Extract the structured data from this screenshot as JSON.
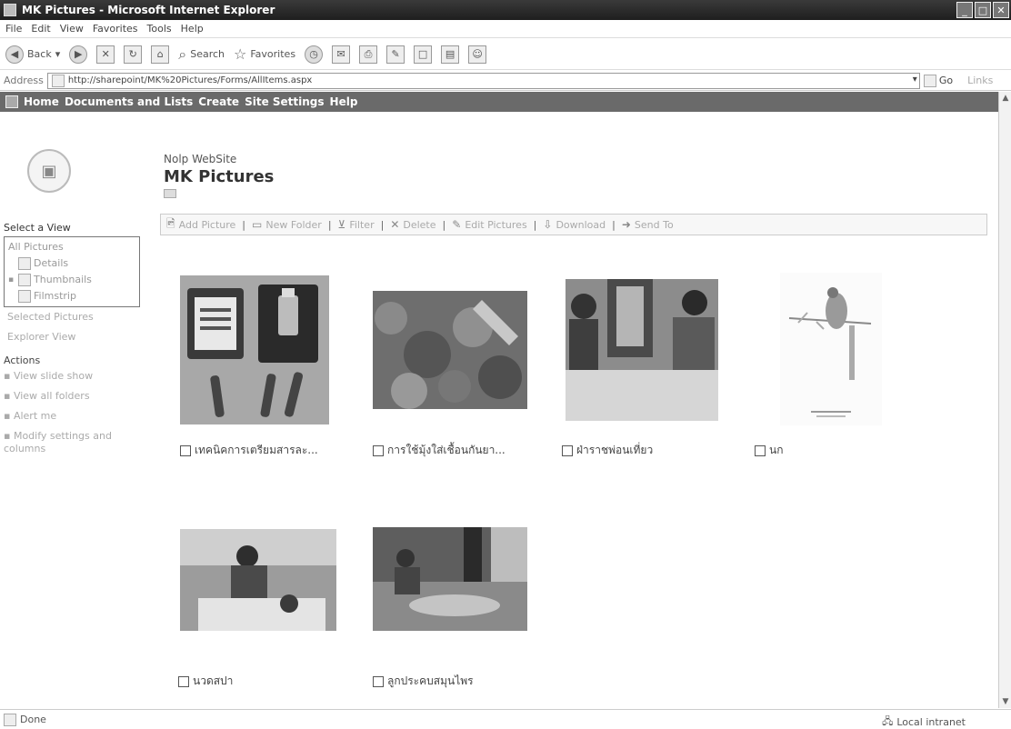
{
  "window": {
    "title": "MK Pictures - Microsoft Internet Explorer"
  },
  "menu": [
    "File",
    "Edit",
    "View",
    "Favorites",
    "Tools",
    "Help"
  ],
  "toolbar": {
    "back_label": "Back",
    "search_label": "Search",
    "favorites_label": "Favorites"
  },
  "address": {
    "label": "Address",
    "url": "http://sharepoint/MK%20Pictures/Forms/AllItems.aspx",
    "go_label": "Go",
    "links_label": "Links"
  },
  "topnav": [
    "Home",
    "Documents and Lists",
    "Create",
    "Site Settings",
    "Help"
  ],
  "site": {
    "name": "Nolp WebSite",
    "title": "MK Pictures"
  },
  "leftnav": {
    "select_view_heading": "Select a View",
    "views": [
      {
        "label": "All Pictures",
        "icon": "none"
      },
      {
        "label": "Details",
        "icon": "details-icon"
      },
      {
        "label": "Thumbnails",
        "icon": "thumbnails-icon",
        "selected": true
      },
      {
        "label": "Filmstrip",
        "icon": "filmstrip-icon"
      }
    ],
    "extra_views": [
      "Selected Pictures",
      "Explorer View"
    ],
    "actions_heading": "Actions",
    "actions": [
      "View slide show",
      "View all folders",
      "Alert me",
      "Modify settings and columns"
    ]
  },
  "action_toolbar": [
    "Add Picture",
    "New Folder",
    "Filter",
    "Delete",
    "Edit Pictures",
    "Download",
    "Send To"
  ],
  "pictures": [
    {
      "caption": "เทคนิคการเตรียมสารละ..."
    },
    {
      "caption": "การใช้มุ้งใส่เชื้อนกันยา..."
    },
    {
      "caption": "ฝ่าราชพ่อนเที่ยว"
    },
    {
      "caption": "นก"
    },
    {
      "caption": "นวดสปา"
    },
    {
      "caption": "ลูกประคบสมุนไพร"
    }
  ],
  "status": {
    "left": "Done",
    "zone": "Local intranet"
  }
}
